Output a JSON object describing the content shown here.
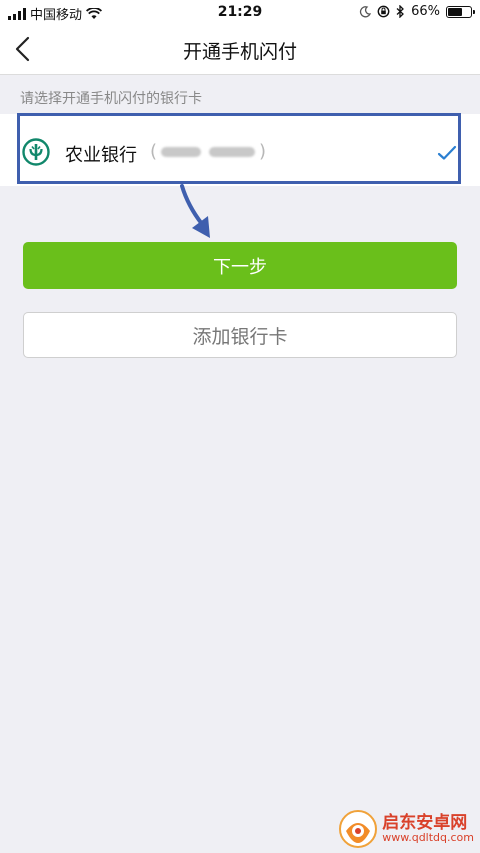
{
  "status_bar": {
    "carrier": "中国移动",
    "time": "21:29",
    "battery_percent": "66%",
    "battery_level": 0.66,
    "icons": [
      "signal-icon",
      "wifi-icon",
      "moon-icon",
      "rotation-lock-icon",
      "bluetooth-icon",
      "battery-icon"
    ]
  },
  "nav": {
    "title": "开通手机闪付",
    "back_icon": "chevron-left-icon"
  },
  "hint": "请选择开通手机闪付的银行卡",
  "bank_card": {
    "bank_name": "农业银行",
    "card_number_masked": "(",
    "card_number_close": ")",
    "logo_icon": "abc-bank-logo-icon",
    "selected": true,
    "check_icon": "checkmark-icon"
  },
  "buttons": {
    "next_label": "下一步",
    "add_card_label": "添加银行卡"
  },
  "watermark": {
    "name": "启东安卓网",
    "url": "www.qdltdq.com"
  },
  "colors": {
    "accent_green": "#6abf1b",
    "check_blue": "#2a7fd1",
    "annotation_blue": "#3f5fae",
    "bank_logo_green": "#11876b",
    "watermark_red": "#d9412a"
  }
}
